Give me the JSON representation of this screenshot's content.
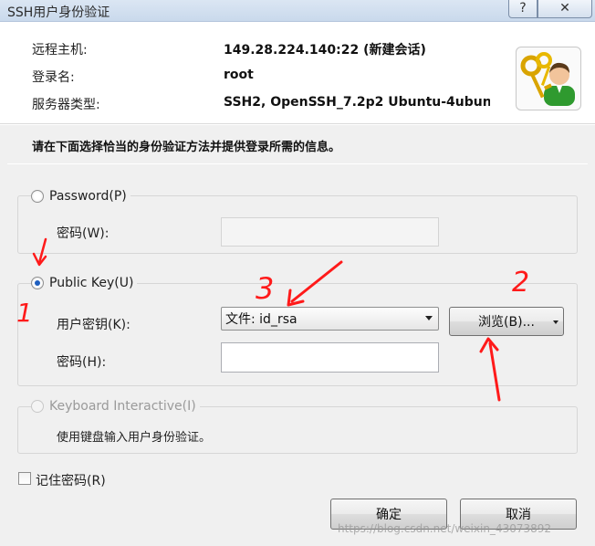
{
  "window": {
    "title": "SSH用户身份验证",
    "help_glyph": "?",
    "close_glyph": "✕"
  },
  "info": {
    "host_label": "远程主机:",
    "host_value": "149.28.224.140:22 (新建会话)",
    "login_label": "登录名:",
    "login_value": "root",
    "server_type_label": "服务器类型:",
    "server_type_value": "SSH2, OpenSSH_7.2p2 Ubuntu-4ubuntu",
    "logo_icon": "key-user-icon"
  },
  "instruction": "请在下面选择恰当的身份验证方法并提供登录所需的信息。",
  "password_group": {
    "label": "Password(P)",
    "checked": false,
    "field_label": "密码(W):",
    "field_value": ""
  },
  "publickey_group": {
    "label": "Public Key(U)",
    "checked": true,
    "key_label": "用户密钥(K):",
    "key_value": "文件: id_rsa",
    "browse_label": "浏览(B)...",
    "passphrase_label": "密码(H):",
    "passphrase_value": ""
  },
  "keyboard_group": {
    "label": "Keyboard Interactive(I)",
    "checked": false,
    "description": "使用键盘输入用户身份验证。"
  },
  "remember": {
    "label": "记住密码(R)",
    "checked": false
  },
  "buttons": {
    "ok": "确定",
    "cancel": "取消"
  },
  "annotations": {
    "mark_1": "1",
    "mark_2": "2",
    "mark_3": "3",
    "color": "#ff1a1a"
  },
  "watermark": "https://blog.csdn.net/weixin_43073892"
}
